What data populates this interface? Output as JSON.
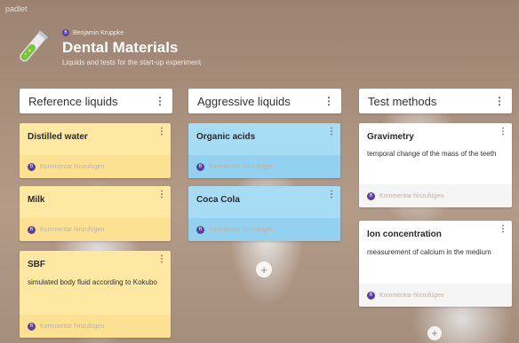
{
  "app": {
    "name": "padlet"
  },
  "board": {
    "author": "Benjamin Kruppke",
    "author_initial": "B",
    "title": "Dental Materials",
    "subtitle": "Liquids and tests for the start-up experiment"
  },
  "columns": [
    {
      "title": "Reference liquids",
      "cards": [
        {
          "title": "Distilled water",
          "body": "",
          "comment": "Kommentar hinzufügen"
        },
        {
          "title": "Milk",
          "body": "",
          "comment": "Kommentar hinzufügen"
        },
        {
          "title": "SBF",
          "body": "simulated body fluid according to Kokubo",
          "comment": "Kommentar hinzufügen"
        }
      ]
    },
    {
      "title": "Aggressive liquids",
      "cards": [
        {
          "title": "Organic acids",
          "body": "",
          "comment": "Kommentar hinzufügen"
        },
        {
          "title": "Coca Cola",
          "body": "",
          "comment": "Kommentar hinzufügen"
        }
      ]
    },
    {
      "title": "Test methods",
      "cards": [
        {
          "title": "Gravimetry",
          "body": "temporal change of the mass of the teeth",
          "comment": "Kommentar hinzufügen"
        },
        {
          "title": "Ion concentration",
          "body": "measurement of calcium in the medium",
          "comment": "Kommentar hinzufügen"
        }
      ]
    }
  ],
  "icons": {
    "kebab": "⋮",
    "add": "+"
  },
  "colors": {
    "reference": "#ffe8a2",
    "aggressive": "#a7dcf5",
    "methods": "#ffffff",
    "avatar": "#5a3fa0"
  }
}
